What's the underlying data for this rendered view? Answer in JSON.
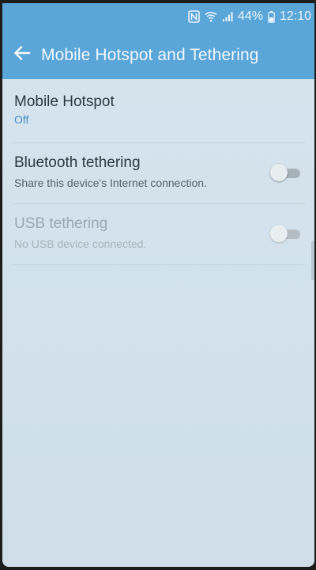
{
  "status_bar": {
    "nfc_icon": "nfc-icon",
    "wifi_icon": "wifi-icon",
    "signal_icon": "signal-icon",
    "battery": "44%",
    "battery_icon": "battery-icon",
    "time": "12:10"
  },
  "app_bar": {
    "back_icon": "arrow-left-icon",
    "title": "Mobile Hotspot and Tethering",
    "color": "#5aa6d8"
  },
  "settings": [
    {
      "title": "Mobile Hotspot",
      "subtitle": "Off",
      "has_toggle": false
    },
    {
      "title": "Bluetooth tethering",
      "subtitle": "Share this device's Internet connection.",
      "has_toggle": true,
      "toggle_state": "off",
      "enabled": true
    },
    {
      "title": "USB tethering",
      "subtitle": "No USB device connected.",
      "has_toggle": true,
      "toggle_state": "off",
      "enabled": false
    }
  ]
}
